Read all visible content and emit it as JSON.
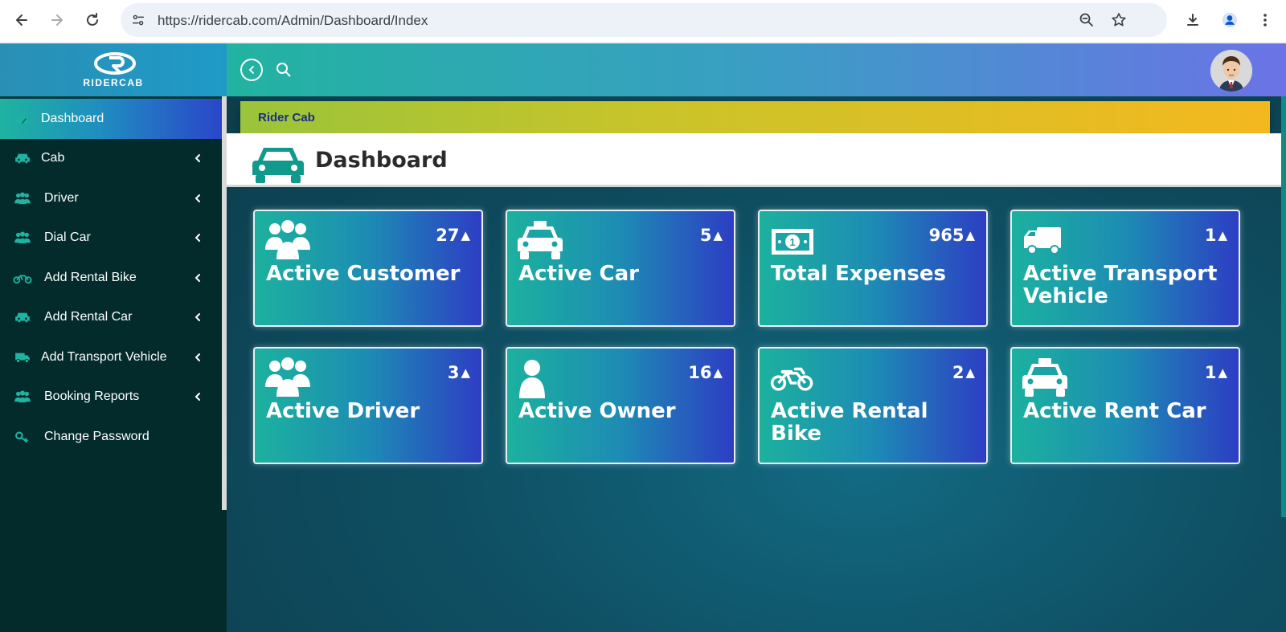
{
  "browser": {
    "url": "https://ridercab.com/Admin/Dashboard/Index"
  },
  "brand": {
    "logo_text": "RIDERCAB"
  },
  "sidebar": {
    "items": [
      {
        "label": "Dashboard",
        "icon": "gauge-icon",
        "active": true,
        "has_chevron": false
      },
      {
        "label": "Cab",
        "icon": "car-icon",
        "active": false,
        "has_chevron": true
      },
      {
        "label": "Driver",
        "icon": "users-icon",
        "active": false,
        "has_chevron": true
      },
      {
        "label": "Dial Car",
        "icon": "users-icon",
        "active": false,
        "has_chevron": true
      },
      {
        "label": "Add Rental Bike",
        "icon": "bike-icon",
        "active": false,
        "has_chevron": true
      },
      {
        "label": "Add Rental Car",
        "icon": "car-icon",
        "active": false,
        "has_chevron": true
      },
      {
        "label": "Add Transport Vehicle",
        "icon": "truck-icon",
        "active": false,
        "has_chevron": true
      },
      {
        "label": "Booking Reports",
        "icon": "users-icon",
        "active": false,
        "has_chevron": true
      },
      {
        "label": "Change Password",
        "icon": "key-icon",
        "active": false,
        "has_chevron": false
      }
    ]
  },
  "breadcrumb": {
    "text": "Rider Cab"
  },
  "page": {
    "title": "Dashboard"
  },
  "cards": [
    {
      "label": "Active Customer",
      "count": "27",
      "icon": "users-icon"
    },
    {
      "label": "Active Car",
      "count": "5",
      "icon": "taxi-icon"
    },
    {
      "label": "Total Expenses",
      "count": "965",
      "icon": "money-icon"
    },
    {
      "label": "Active Transport Vehicle",
      "count": "1",
      "icon": "truck-icon"
    },
    {
      "label": "Active Driver",
      "count": "3",
      "icon": "users-icon"
    },
    {
      "label": "Active Owner",
      "count": "16",
      "icon": "user-icon"
    },
    {
      "label": "Active Rental Bike",
      "count": "2",
      "icon": "motorcycle-icon"
    },
    {
      "label": "Active Rent Car",
      "count": "1",
      "icon": "taxi-icon"
    }
  ],
  "colors": {
    "sidebar_bg": "#032b2b",
    "accent_teal": "#1cb19e",
    "accent_blue": "#2d3ec4",
    "breadcrumb_text": "#1a2d8a"
  }
}
